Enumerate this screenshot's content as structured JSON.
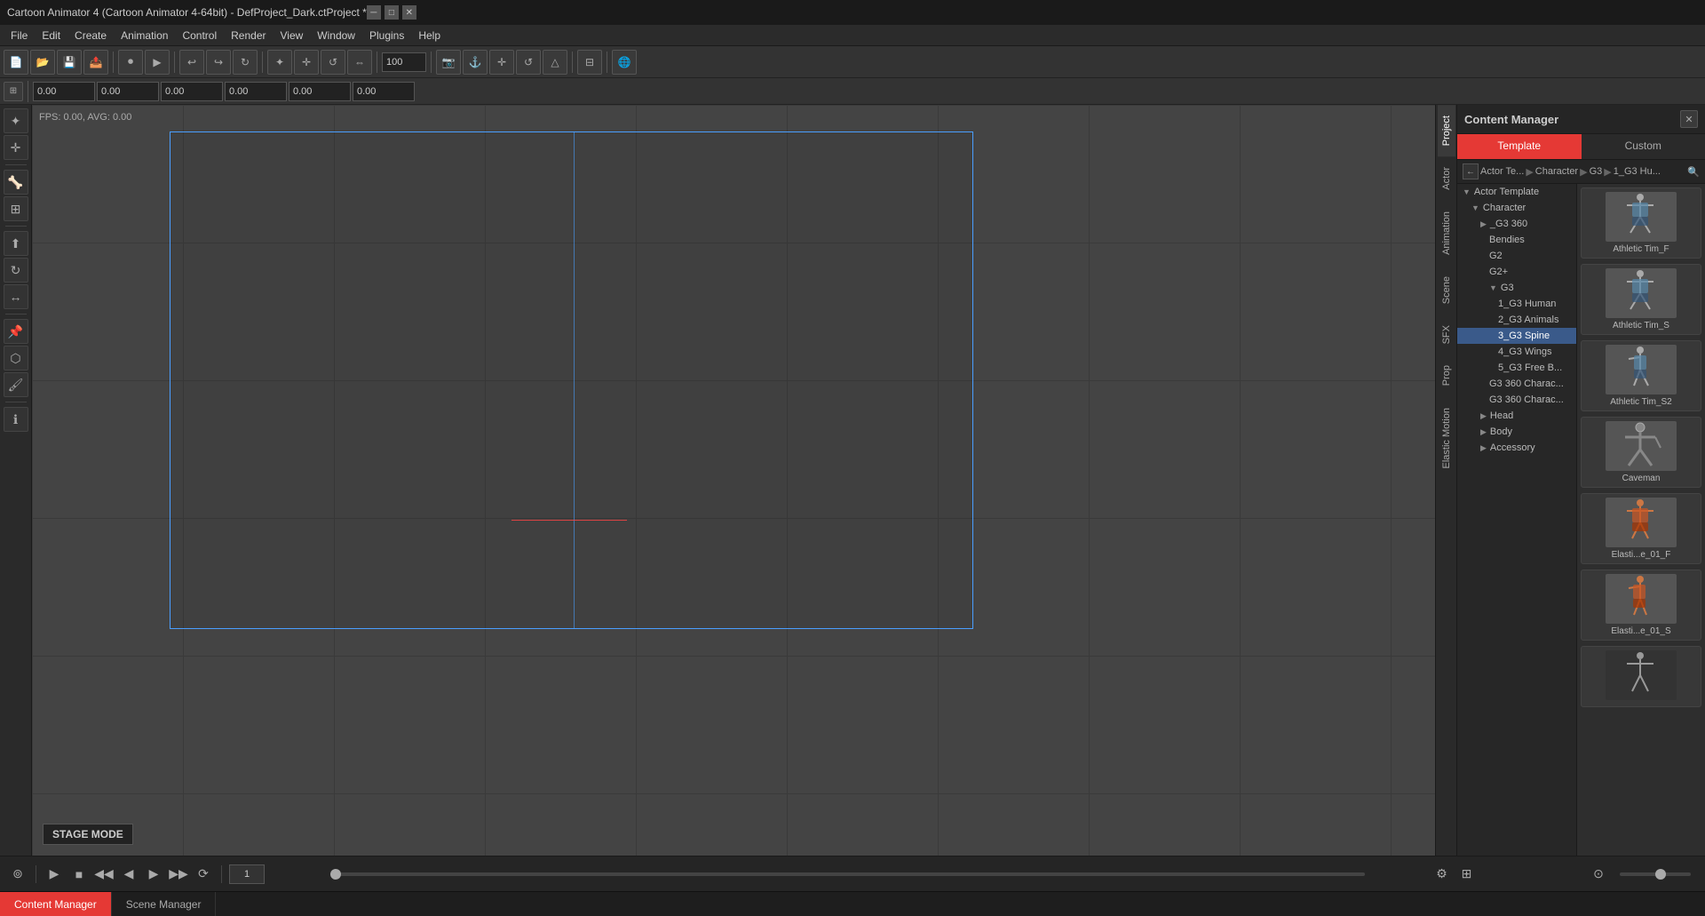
{
  "window": {
    "title": "Cartoon Animator 4 (Cartoon Animator 4-64bit) - DefProject_Dark.ctProject *"
  },
  "menu": {
    "items": [
      "File",
      "Edit",
      "Create",
      "Animation",
      "Control",
      "Render",
      "View",
      "Window",
      "Plugins",
      "Help"
    ]
  },
  "toolbar1": {
    "buttons": [
      "new",
      "open",
      "save",
      "export",
      "record",
      "play",
      "undo",
      "undo-arrow",
      "redo",
      "select",
      "move",
      "rotate",
      "scale",
      "mirror",
      "timeline",
      "globe"
    ]
  },
  "toolbar2": {
    "fields": [
      "x",
      "y",
      "w",
      "h",
      "z",
      "angle"
    ]
  },
  "canvas": {
    "fps_label": "FPS: 0.00, AVG: 0.00",
    "stage_mode": "STAGE MODE"
  },
  "right_panel_tabs": {
    "tabs": [
      "Project",
      "Actor",
      "Animation",
      "Scene",
      "SFX",
      "Prop",
      "Elastic Motion"
    ]
  },
  "content_manager": {
    "title": "Content Manager",
    "tabs": [
      {
        "label": "Template",
        "active": true
      },
      {
        "label": "Custom",
        "active": false
      }
    ],
    "breadcrumb": [
      "Actor Te...",
      "Character",
      "G3",
      "1_G3 Hu..."
    ],
    "tree": {
      "root": "Actor Template",
      "nodes": [
        {
          "label": "Actor Template",
          "level": 0,
          "expanded": true,
          "type": "parent"
        },
        {
          "label": "Character",
          "level": 1,
          "expanded": true,
          "type": "parent"
        },
        {
          "label": "_G3 360",
          "level": 2,
          "expanded": true,
          "type": "parent"
        },
        {
          "label": "Bendies",
          "level": 3,
          "type": "leaf"
        },
        {
          "label": "G2",
          "level": 3,
          "type": "leaf"
        },
        {
          "label": "G2+",
          "level": 3,
          "type": "leaf"
        },
        {
          "label": "G3",
          "level": 3,
          "expanded": true,
          "type": "parent"
        },
        {
          "label": "1_G3 Human",
          "level": 4,
          "type": "leaf"
        },
        {
          "label": "2_G3 Animals",
          "level": 4,
          "type": "leaf"
        },
        {
          "label": "3_G3 Spine",
          "level": 4,
          "type": "leaf",
          "selected": true
        },
        {
          "label": "4_G3 Wings",
          "level": 4,
          "type": "leaf"
        },
        {
          "label": "5_G3 Free B...",
          "level": 4,
          "type": "leaf"
        },
        {
          "label": "G3 360 Charac...",
          "level": 3,
          "type": "leaf"
        },
        {
          "label": "G3 360 Charac...",
          "level": 3,
          "type": "leaf"
        },
        {
          "label": "Head",
          "level": 2,
          "type": "parent"
        },
        {
          "label": "Body",
          "level": 2,
          "type": "parent"
        },
        {
          "label": "Accessory",
          "level": 2,
          "type": "parent"
        }
      ]
    },
    "assets": [
      {
        "label": "Athletic Tim_F",
        "type": "character-f"
      },
      {
        "label": "Athletic Tim_S",
        "type": "character-s"
      },
      {
        "label": "Athletic Tim_S2",
        "type": "character-s2"
      },
      {
        "label": "Caveman",
        "type": "caveman"
      },
      {
        "label": "Elasti...e_01_F",
        "type": "elastic-f"
      },
      {
        "label": "Elasti...e_01_S",
        "type": "elastic-s"
      },
      {
        "label": "",
        "type": "more"
      }
    ]
  },
  "bottom_bar": {
    "play_btn": "▶",
    "stop_btn": "■",
    "prev_btn": "◀◀",
    "next_btn": "▶▶",
    "prev_frame": "◀",
    "next_frame": "▶",
    "record_btn": "⏺",
    "frame_input": "1",
    "settings_btn": "⚙",
    "layout_btn": "⊞"
  },
  "bottom_tabs": [
    {
      "label": "Content Manager",
      "active": true
    },
    {
      "label": "Scene Manager",
      "active": false
    }
  ],
  "icons": {
    "close": "✕",
    "arrow_right": "▶",
    "arrow_down": "▼",
    "arrow_back": "◀",
    "expand": "▶",
    "gear": "⚙",
    "refresh": "↺",
    "back": "←"
  }
}
